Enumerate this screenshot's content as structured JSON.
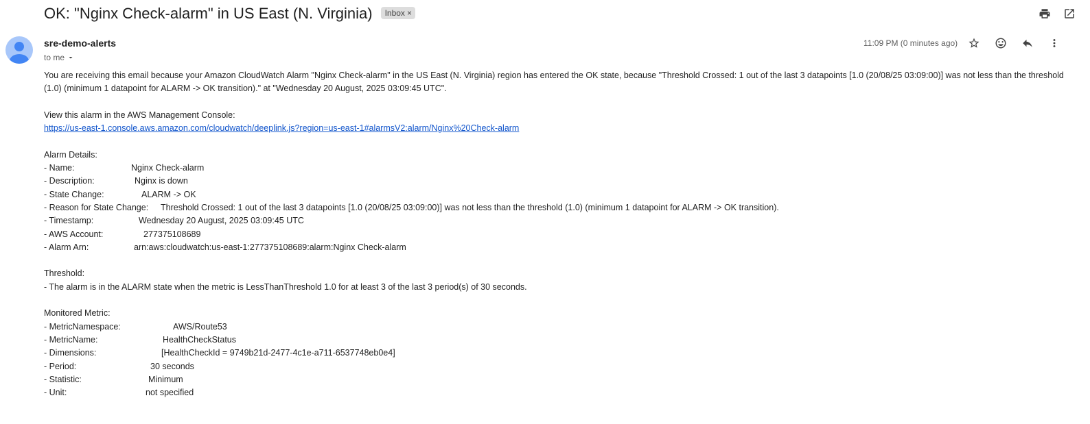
{
  "header": {
    "subject": "OK: \"Nginx Check-alarm\" in US East (N. Virginia)",
    "inbox_label": "Inbox",
    "chip_close": "×"
  },
  "icons": {
    "print": "print-icon",
    "open_new_window": "open-in-new-window-icon",
    "star": "star-icon",
    "emoji": "emoji-icon",
    "reply": "reply-icon",
    "more": "more-vert-icon",
    "avatar": "avatar-person-icon"
  },
  "colors": {
    "avatar_bg": "#a8c7fa",
    "avatar_fg": "#4285f4",
    "link": "#1155cc"
  },
  "message": {
    "sender": "sre-demo-alerts",
    "to": "to me",
    "time": "11:09 PM (0 minutes ago)",
    "intro": "You are receiving this email because your Amazon CloudWatch Alarm \"Nginx Check-alarm\" in the US East (N. Virginia) region has entered the OK state, because \"Threshold Crossed: 1 out of the last 3 datapoints [1.0 (20/08/25 03:09:00)] was not less than the threshold (1.0) (minimum 1 datapoint for ALARM -> OK transition).\" at \"Wednesday 20 August, 2025 03:09:45 UTC\".",
    "view_text": "View this alarm in the AWS Management Console:",
    "console_link": "https://us-east-1.console.aws.amazon.com/cloudwatch/deeplink.js?region=us-east-1#alarmsV2:alarm/Nginx%20Check-alarm",
    "alarm_details_heading": "Alarm Details:",
    "alarm_details": [
      {
        "label": "- Name:",
        "value": "Nginx Check-alarm"
      },
      {
        "label": "- Description:",
        "value": "Nginx is down"
      },
      {
        "label": "- State Change:",
        "value": "ALARM -> OK"
      },
      {
        "label": "- Reason for State Change:",
        "value": "Threshold Crossed: 1 out of the last 3 datapoints [1.0 (20/08/25 03:09:00)] was not less than the threshold (1.0) (minimum 1 datapoint for ALARM -> OK transition)."
      },
      {
        "label": "- Timestamp:",
        "value": "Wednesday 20 August, 2025 03:09:45 UTC"
      },
      {
        "label": "- AWS Account:",
        "value": "277375108689"
      },
      {
        "label": "- Alarm Arn:",
        "value": "arn:aws:cloudwatch:us-east-1:277375108689:alarm:Nginx Check-alarm"
      }
    ],
    "threshold_heading": "Threshold:",
    "threshold_text": "- The alarm is in the ALARM state when the metric is LessThanThreshold 1.0 for at least 3 of the last 3 period(s) of 30 seconds.",
    "metric_heading": "Monitored Metric:",
    "metric_details": [
      {
        "label": "- MetricNamespace:",
        "value": "AWS/Route53"
      },
      {
        "label": "- MetricName:",
        "value": "HealthCheckStatus"
      },
      {
        "label": "- Dimensions:",
        "value": "[HealthCheckId = 9749b21d-2477-4c1e-a711-6537748eb0e4]"
      },
      {
        "label": "- Period:",
        "value": "30 seconds"
      },
      {
        "label": "- Statistic:",
        "value": "Minimum"
      },
      {
        "label": "- Unit:",
        "value": "not specified"
      }
    ]
  }
}
